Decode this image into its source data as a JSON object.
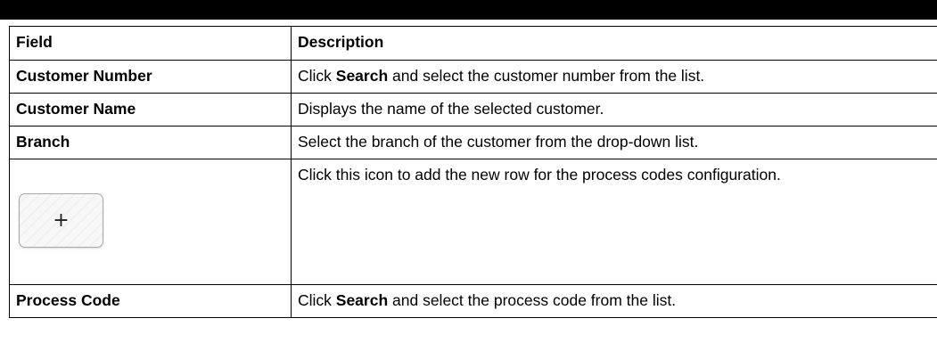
{
  "table": {
    "headers": {
      "field": "Field",
      "description": "Description"
    },
    "rows": [
      {
        "field": "Customer Number",
        "desc_pre": "Click ",
        "desc_strong": "Search",
        "desc_post": " and select the customer number from the list."
      },
      {
        "field": "Customer Name",
        "description": "Displays the name of the selected customer."
      },
      {
        "field": "Branch",
        "description": "Select the branch of the customer from the drop-down list."
      },
      {
        "icon": "plus-icon",
        "icon_glyph": "+",
        "description": "Click this icon to add the new row for the process codes configuration."
      },
      {
        "field": "Process Code",
        "desc_pre": "Click ",
        "desc_strong": "Search",
        "desc_post": " and select the process code from the list."
      }
    ]
  }
}
